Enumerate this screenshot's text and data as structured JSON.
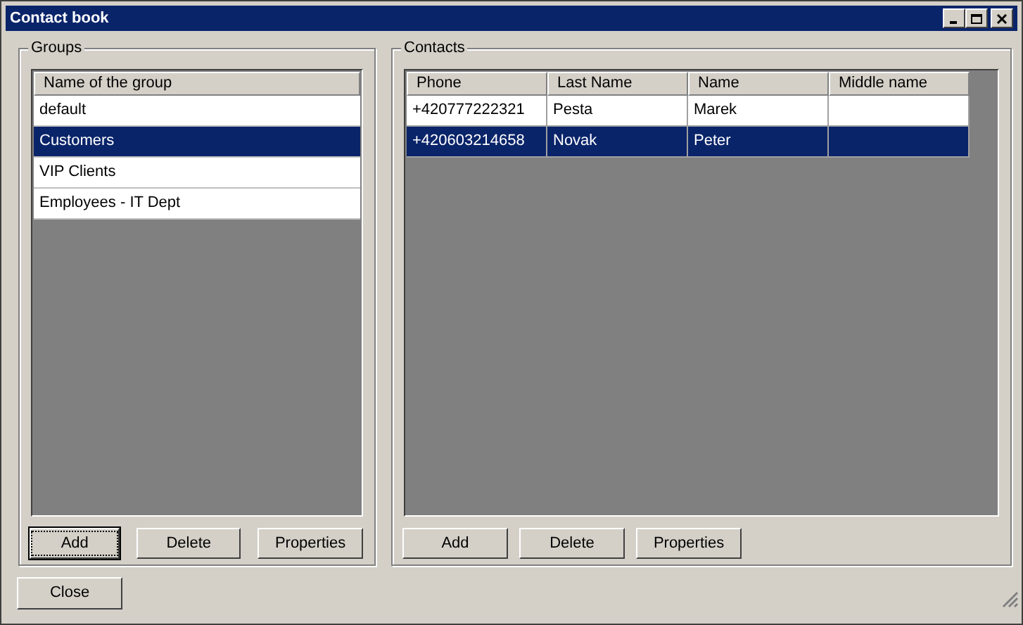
{
  "window": {
    "title": "Contact book"
  },
  "groups": {
    "title": "Groups",
    "column": "Name of the group",
    "rows": [
      {
        "name": "default",
        "selected": false
      },
      {
        "name": "Customers",
        "selected": true
      },
      {
        "name": "VIP Clients",
        "selected": false
      },
      {
        "name": "Employees - IT Dept",
        "selected": false
      }
    ],
    "buttons": [
      {
        "label": "Add",
        "focused": true
      },
      {
        "label": "Delete",
        "focused": false
      },
      {
        "label": "Properties",
        "focused": false
      }
    ]
  },
  "contacts": {
    "title": "Contacts",
    "columns": [
      "Phone",
      "Last Name",
      "Name",
      "Middle name"
    ],
    "rows": [
      {
        "cells": [
          "+420777222321",
          "Pesta",
          "Marek",
          ""
        ],
        "selected": false
      },
      {
        "cells": [
          "+420603214658",
          "Novak",
          "Peter",
          ""
        ],
        "selected": true
      }
    ],
    "buttons": [
      {
        "label": "Add",
        "focused": false
      },
      {
        "label": "Delete",
        "focused": false
      },
      {
        "label": "Properties",
        "focused": false
      }
    ]
  },
  "close_button": "Close"
}
